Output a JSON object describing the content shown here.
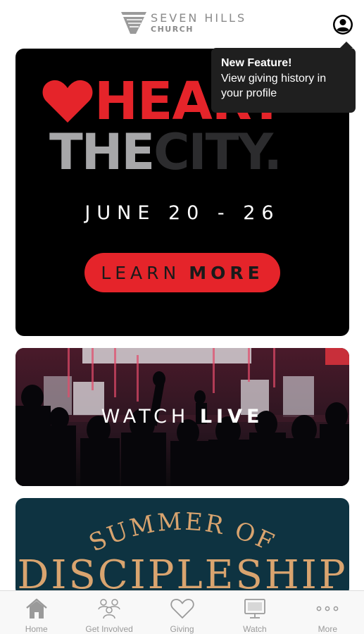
{
  "header": {
    "logo_top": "SEVEN HILLS",
    "logo_bottom": "CHURCH",
    "profile_icon": "profile-icon"
  },
  "tooltip": {
    "title": "New Feature!",
    "body": "View giving history in your profile"
  },
  "cards": {
    "heart_the_city": {
      "heart_word": "HEART",
      "the_word": "THE",
      "city_word": "CITY.",
      "dates": "JUNE 20 - 26",
      "button_light": "LEARN",
      "button_bold": "MORE"
    },
    "watch_live": {
      "light": "WATCH",
      "bold": "LIVE"
    },
    "summer": {
      "line1": "SUMMER OF",
      "line2": "DISCIPLESHIP"
    }
  },
  "tabs": [
    {
      "label": "Home",
      "icon": "home-icon"
    },
    {
      "label": "Get Involved",
      "icon": "people-icon"
    },
    {
      "label": "Giving",
      "icon": "heart-icon"
    },
    {
      "label": "Watch",
      "icon": "monitor-icon"
    },
    {
      "label": "More",
      "icon": "more-icon"
    }
  ],
  "colors": {
    "accent_red": "#e5242a",
    "tab_gray": "#9a9a9a",
    "tooltip_bg": "#1f1f1f",
    "summer_bg": "#0e3341",
    "summer_gold": "#d9a46f"
  }
}
